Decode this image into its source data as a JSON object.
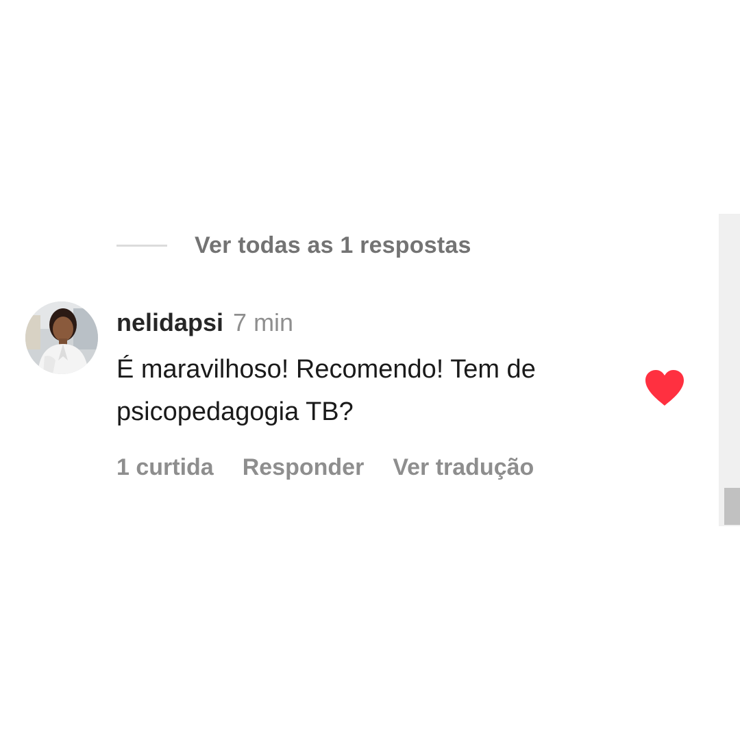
{
  "replies": {
    "view_all_label": "Ver todas as 1 respostas"
  },
  "comment": {
    "username": "nelidapsi",
    "time": "7 min",
    "text": "É maravilhoso! Recomendo! Tem de psicopedagogia TB?",
    "actions": {
      "likes_label": "1 curtida",
      "reply_label": "Responder",
      "translate_label": "Ver tradução"
    },
    "liked": true,
    "like_icon": "heart-filled-icon",
    "like_color": "#ff3040"
  },
  "colors": {
    "secondary_text": "#737373",
    "primary_text": "#262626",
    "scrollbar_track": "#f0f0f0",
    "scrollbar_thumb": "#c1c1c1"
  }
}
